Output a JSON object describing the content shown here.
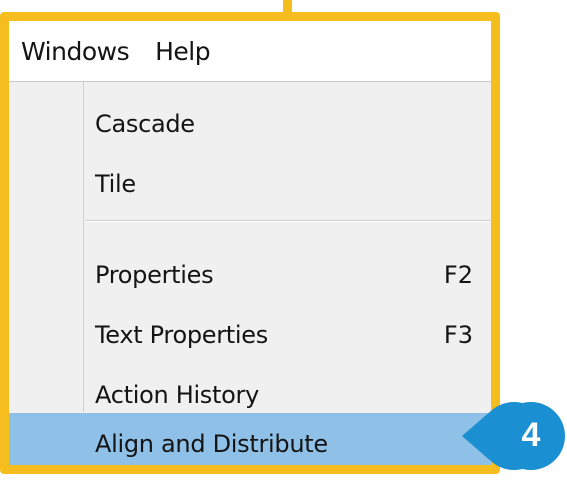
{
  "menubar": {
    "items": [
      {
        "label": "Windows"
      },
      {
        "label": "Help"
      }
    ]
  },
  "menu": {
    "group1": [
      {
        "label": "Cascade",
        "shortcut": ""
      },
      {
        "label": "Tile",
        "shortcut": ""
      }
    ],
    "group2": [
      {
        "label": "Properties",
        "shortcut": "F2"
      },
      {
        "label": "Text Properties",
        "shortcut": "F3"
      },
      {
        "label": "Action History",
        "shortcut": ""
      },
      {
        "label": "Align and Distribute",
        "shortcut": "",
        "highlighted": true
      }
    ]
  },
  "callout": {
    "number": "4"
  },
  "colors": {
    "frame": "#f5be1e",
    "highlight": "#8ec0e8",
    "callout": "#1a8fd1",
    "menu_bg": "#f0f0f0"
  }
}
